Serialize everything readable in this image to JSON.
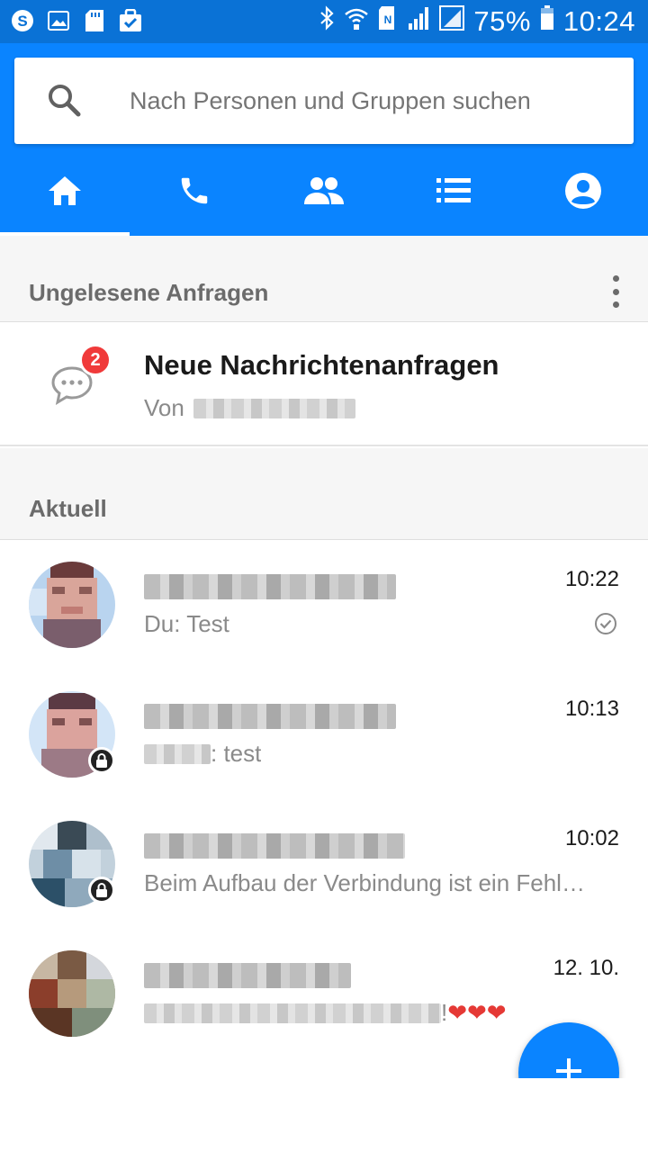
{
  "status_bar": {
    "battery": "75%",
    "time": "10:24",
    "left_icons": [
      "skype-icon",
      "gallery-icon",
      "sd-card-icon",
      "bag-check-icon"
    ],
    "right_icons": [
      "bluetooth-icon",
      "wifi-icon",
      "nfc-icon",
      "signal-icon",
      "signal-icon-2",
      "battery-icon"
    ]
  },
  "search": {
    "placeholder": "Nach Personen und Gruppen suchen"
  },
  "tabs": [
    {
      "name": "home",
      "icon": "home-icon",
      "active": true
    },
    {
      "name": "calls",
      "icon": "phone-icon",
      "active": false
    },
    {
      "name": "groups",
      "icon": "people-icon",
      "active": false
    },
    {
      "name": "list",
      "icon": "list-icon",
      "active": false
    },
    {
      "name": "profile",
      "icon": "account-icon",
      "active": false
    }
  ],
  "requests_section": {
    "title": "Ungelesene Anfragen",
    "item": {
      "title": "Neue Nachrichtenanfragen",
      "subtitle_prefix": "Von",
      "badge": "2"
    }
  },
  "recent_section": {
    "title": "Aktuell"
  },
  "chats": [
    {
      "time": "10:22",
      "preview": "Du: Test",
      "status": "sent-check-icon",
      "locked": false
    },
    {
      "time": "10:13",
      "preview": ": test",
      "locked": true
    },
    {
      "time": "10:02",
      "preview": "Beim Aufbau der Verbindung ist ein Fehl…",
      "locked": true
    },
    {
      "time": "12. 10.",
      "preview": "!",
      "hearts": "❤❤❤",
      "locked": false
    }
  ],
  "colors": {
    "brand_blue": "#0a84ff",
    "status_blue": "#0a72d6",
    "badge_red": "#f03a3a"
  }
}
